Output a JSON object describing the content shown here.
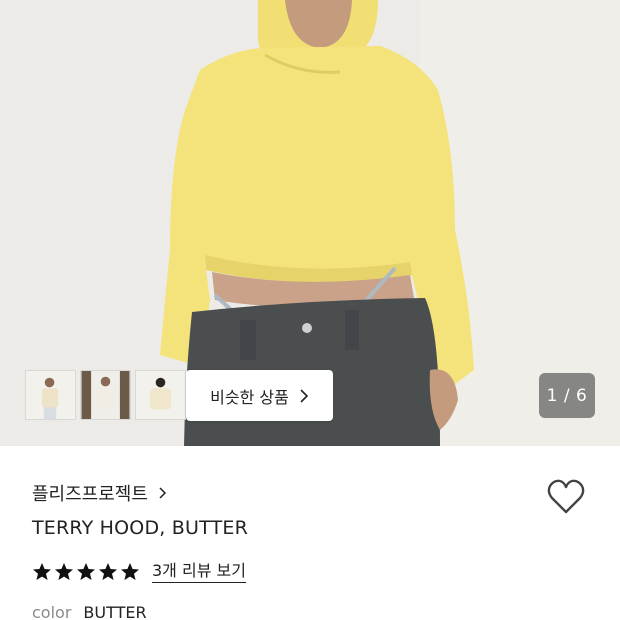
{
  "gallery": {
    "similar_button_label": "비슷한 상품",
    "pager_text": "1 / 6",
    "thumbnails": [
      "thumbnail-1",
      "thumbnail-2",
      "thumbnail-3"
    ]
  },
  "product": {
    "brand": "플리즈프로젝트",
    "title": "TERRY HOOD, BUTTER",
    "rating_stars": 5,
    "review_link": "3개 리뷰 보기",
    "option_label": "color",
    "option_value": "BUTTER"
  },
  "colors": {
    "hoodie": "#f3e37a",
    "pants": "#4a4e4f",
    "star": "#111111"
  },
  "icons": {
    "heart": "heart-outline-icon",
    "chevron": "chevron-right-icon",
    "star": "star-filled-icon"
  }
}
